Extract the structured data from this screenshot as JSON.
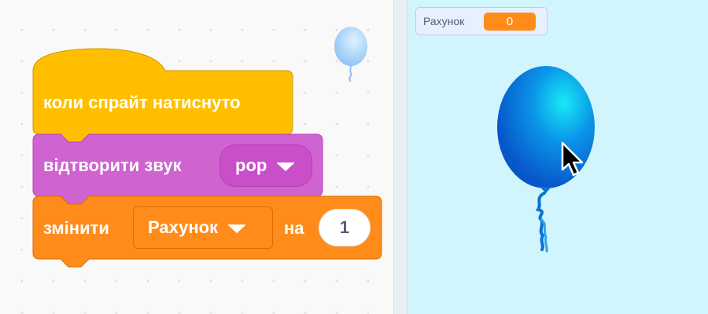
{
  "code_area": {
    "event_block": {
      "label": "коли спрайт натиснуто",
      "color": "#ffbf00"
    },
    "sound_block": {
      "label": "відтворити звук",
      "sound_value": "pop",
      "color": "#cf63cf"
    },
    "variable_block": {
      "label": "змінити",
      "variable_value": "Рахунок",
      "by_label": "на",
      "amount_value": "1",
      "color": "#ff8c1a"
    },
    "sprite_thumbnail": {
      "icon": "balloon-icon",
      "color": "#a9d4ff"
    }
  },
  "stage": {
    "background_color": "#d1f5fd",
    "score_monitor": {
      "label": "Рахунок",
      "value": "0",
      "value_color": "#ff8c1a"
    },
    "balloon_sprite": {
      "icon": "balloon-icon",
      "color": "#0a8fe8"
    },
    "cursor": {
      "icon": "mouse-pointer-icon"
    }
  }
}
